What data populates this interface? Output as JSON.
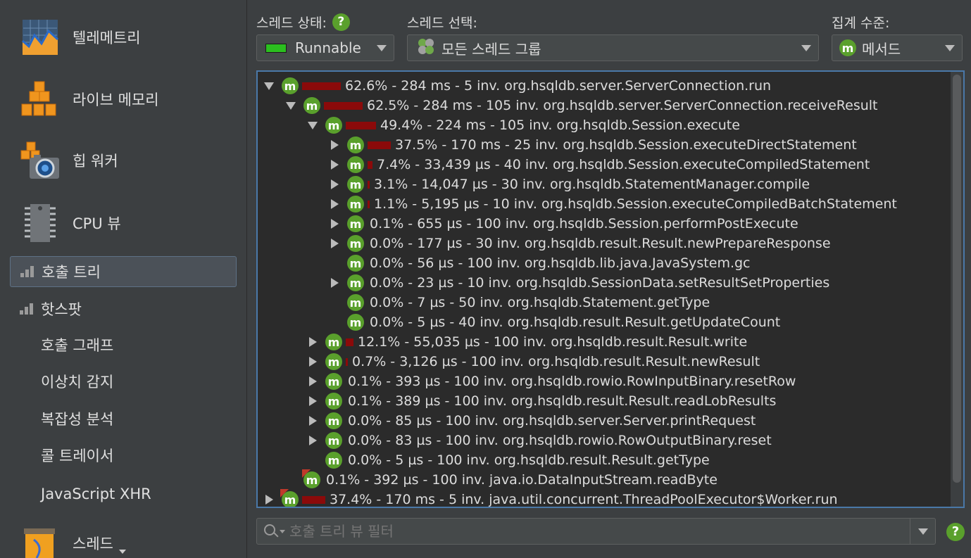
{
  "sidebar": {
    "big_items": [
      {
        "label": "텔레메트리",
        "icon": "telemetry-icon"
      },
      {
        "label": "라이브 메모리",
        "icon": "live-memory-icon"
      },
      {
        "label": "힙 워커",
        "icon": "heap-walker-icon"
      },
      {
        "label": "CPU 뷰",
        "icon": "cpu-icon"
      }
    ],
    "cpu_sections": [
      {
        "label": "호출 트리",
        "selected": true
      },
      {
        "label": "핫스팟",
        "selected": false
      }
    ],
    "cpu_subitems": [
      "호출 그래프",
      "이상치 감지",
      "복잡성 분석",
      "콜 트레이서",
      "JavaScript XHR"
    ],
    "bottom_item": {
      "label": "스레드",
      "icon": "threads-icon"
    }
  },
  "toolbar": {
    "thread_status_label": "스레드 상태:",
    "thread_status_value": "Runnable",
    "thread_select_label": "스레드 선택:",
    "thread_select_value": "모든 스레드 그룹",
    "aggregation_label": "집계 수준:",
    "aggregation_value": "메서드",
    "help_glyph": "?"
  },
  "tree": {
    "rows": [
      {
        "depth": 0,
        "toggle": "expanded",
        "bar": 62.6,
        "text": "62.6% - 284 ms - 5 inv. org.hsqldb.server.ServerConnection.run"
      },
      {
        "depth": 1,
        "toggle": "expanded",
        "bar": 62.5,
        "text": "62.5% - 284 ms - 105 inv. org.hsqldb.server.ServerConnection.receiveResult"
      },
      {
        "depth": 2,
        "toggle": "expanded",
        "bar": 49.4,
        "text": "49.4% - 224 ms - 105 inv. org.hsqldb.Session.execute"
      },
      {
        "depth": 3,
        "toggle": "collapsed",
        "bar": 37.5,
        "text": "37.5% - 170 ms - 25 inv. org.hsqldb.Session.executeDirectStatement"
      },
      {
        "depth": 3,
        "toggle": "collapsed",
        "bar": 7.4,
        "text": "7.4% - 33,439 µs - 40 inv. org.hsqldb.Session.executeCompiledStatement"
      },
      {
        "depth": 3,
        "toggle": "collapsed",
        "bar": 3.1,
        "text": "3.1% - 14,047 µs - 30 inv. org.hsqldb.StatementManager.compile"
      },
      {
        "depth": 3,
        "toggle": "collapsed",
        "bar": 1.1,
        "text": "1.1% - 5,195 µs - 10 inv. org.hsqldb.Session.executeCompiledBatchStatement"
      },
      {
        "depth": 3,
        "toggle": "collapsed",
        "bar": 0.1,
        "text": "0.1% - 655 µs - 100 inv. org.hsqldb.Session.performPostExecute"
      },
      {
        "depth": 3,
        "toggle": "collapsed",
        "bar": 0.0,
        "text": "0.0% - 177 µs - 30 inv. org.hsqldb.result.Result.newPrepareResponse"
      },
      {
        "depth": 3,
        "toggle": "none",
        "bar": 0.0,
        "text": "0.0% - 56 µs - 100 inv. org.hsqldb.lib.java.JavaSystem.gc"
      },
      {
        "depth": 3,
        "toggle": "collapsed",
        "bar": 0.0,
        "text": "0.0% - 23 µs - 10 inv. org.hsqldb.SessionData.setResultSetProperties"
      },
      {
        "depth": 3,
        "toggle": "none",
        "bar": 0.0,
        "text": "0.0% - 7 µs - 50 inv. org.hsqldb.Statement.getType"
      },
      {
        "depth": 3,
        "toggle": "none",
        "bar": 0.0,
        "text": "0.0% - 5 µs - 40 inv. org.hsqldb.result.Result.getUpdateCount"
      },
      {
        "depth": 2,
        "toggle": "collapsed",
        "bar": 12.1,
        "text": "12.1% - 55,035 µs - 100 inv. org.hsqldb.result.Result.write"
      },
      {
        "depth": 2,
        "toggle": "collapsed",
        "bar": 0.7,
        "text": "0.7% - 3,126 µs - 100 inv. org.hsqldb.result.Result.newResult"
      },
      {
        "depth": 2,
        "toggle": "collapsed",
        "bar": 0.1,
        "text": "0.1% - 393 µs - 100 inv. org.hsqldb.rowio.RowInputBinary.resetRow"
      },
      {
        "depth": 2,
        "toggle": "collapsed",
        "bar": 0.1,
        "text": "0.1% - 389 µs - 100 inv. org.hsqldb.result.Result.readLobResults"
      },
      {
        "depth": 2,
        "toggle": "collapsed",
        "bar": 0.0,
        "text": "0.0% - 85 µs - 100 inv. org.hsqldb.server.Server.printRequest"
      },
      {
        "depth": 2,
        "toggle": "collapsed",
        "bar": 0.0,
        "text": "0.0% - 83 µs - 100 inv. org.hsqldb.rowio.RowOutputBinary.reset"
      },
      {
        "depth": 2,
        "toggle": "none",
        "bar": 0.0,
        "text": "0.0% - 5 µs - 100 inv. org.hsqldb.result.Result.getType"
      },
      {
        "depth": 1,
        "toggle": "none",
        "bar": 0.1,
        "text": "0.1% - 392 µs - 100 inv. java.io.DataInputStream.readByte",
        "corner": true
      },
      {
        "depth": 0,
        "toggle": "collapsed",
        "bar": 37.4,
        "text": "37.4% - 170 ms - 5 inv. java.util.concurrent.ThreadPoolExecutor$Worker.run",
        "corner": true
      }
    ]
  },
  "filter": {
    "placeholder": "호출 트리 뷰 필터"
  }
}
